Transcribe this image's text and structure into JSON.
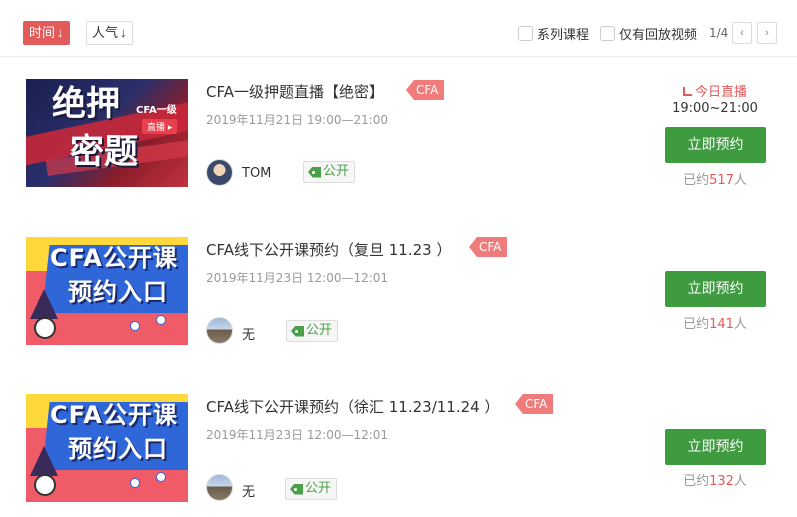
{
  "toolbar": {
    "sort_time": "时间",
    "sort_popularity": "人气",
    "sort_arrow": "↓",
    "filter_series": "系列课程",
    "filter_replay": "仅有回放视频",
    "pager": "1/4",
    "prev_icon": "‹",
    "next_icon": "›"
  },
  "courses": [
    {
      "title": "CFA一级押题直播【绝密】",
      "tag": "CFA",
      "date": "2019年11月21日 19:00—21:00",
      "teacher": "TOM",
      "visibility": "公开",
      "live_label": "今日直播",
      "live_time": "19:00~21:00",
      "button": "立即预约",
      "booked_prefix": "已约",
      "booked_count": "517",
      "booked_suffix": "人",
      "thumb": {
        "line1": "绝押",
        "line2": "密题",
        "mini": "CFA一级",
        "badge": "直播 ▸"
      }
    },
    {
      "title": "CFA线下公开课预约（复旦 11.23 ）",
      "tag": "CFA",
      "date": "2019年11月23日 12:00—12:01",
      "teacher": "无",
      "visibility": "公开",
      "button": "立即预约",
      "booked_prefix": "已约",
      "booked_count": "141",
      "booked_suffix": "人",
      "thumb": {
        "line1": "CFA公开课",
        "line2": "预约入口"
      }
    },
    {
      "title": "CFA线下公开课预约（徐汇 11.23/11.24 ）",
      "tag": "CFA",
      "date": "2019年11月23日 12:00—12:01",
      "teacher": "无",
      "visibility": "公开",
      "button": "立即预约",
      "booked_prefix": "已约",
      "booked_count": "132",
      "booked_suffix": "人",
      "thumb": {
        "line1": "CFA公开课",
        "line2": "预约入口"
      }
    }
  ],
  "colors": {
    "accent": "#e25a5a",
    "button": "#3f9b3f",
    "tag": "#f07b7b",
    "open": "#4aa04a"
  }
}
